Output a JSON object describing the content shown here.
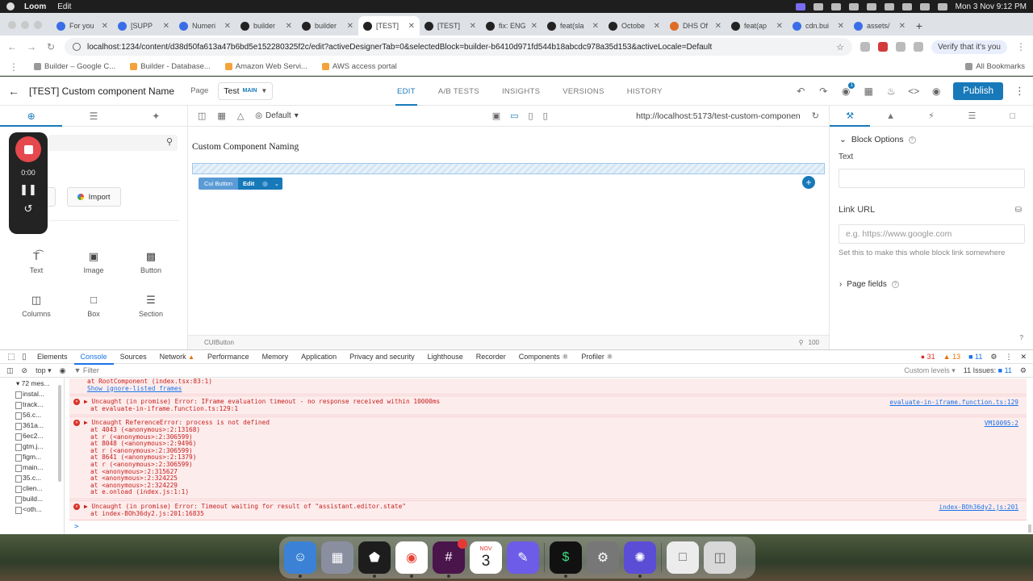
{
  "menubar": {
    "app": "Loom",
    "menu": "Edit",
    "datetime": "Mon 3 Nov  9:12 PM"
  },
  "browser": {
    "tabs": [
      {
        "label": "For you",
        "favicon": "blue"
      },
      {
        "label": "[SUPP",
        "favicon": "blue"
      },
      {
        "label": "Numeri",
        "favicon": "blue"
      },
      {
        "label": "builder",
        "favicon": "black"
      },
      {
        "label": "builder",
        "favicon": "black"
      },
      {
        "label": "[TEST]",
        "favicon": "black",
        "active": true
      },
      {
        "label": "[TEST]",
        "favicon": "black"
      },
      {
        "label": "fix: ENG",
        "favicon": "black"
      },
      {
        "label": "feat(sla",
        "favicon": "black"
      },
      {
        "label": "Octobe",
        "favicon": "black"
      },
      {
        "label": "DHS Of",
        "favicon": "orange"
      },
      {
        "label": "feat(ap",
        "favicon": "black"
      },
      {
        "label": "cdn.bui",
        "favicon": "blue"
      },
      {
        "label": "assets/",
        "favicon": "blue"
      }
    ],
    "url": "localhost:1234/content/d38d50fa613a47b6bd5e152280325f2c/edit?activeDesignerTab=0&selectedBlock=builder-b6410d971fd544b18abcdc978a35d153&activeLocale=Default",
    "verify_label": "Verify that it's you",
    "bookmarks": [
      {
        "label": "Builder – Google C...",
        "color": "grey"
      },
      {
        "label": "Builder - Database...",
        "color": "orange"
      },
      {
        "label": "Amazon Web Servi...",
        "color": "orange"
      },
      {
        "label": "AWS access portal",
        "color": "orange"
      }
    ],
    "all_bookmarks": "All Bookmarks"
  },
  "editor": {
    "title": "[TEST] Custom component Name",
    "type": "Page",
    "model": "Test",
    "model_branch": "MAIN",
    "tabs": [
      {
        "label": "EDIT",
        "active": true
      },
      {
        "label": "A/B TESTS"
      },
      {
        "label": "INSIGHTS"
      },
      {
        "label": "VERSIONS"
      },
      {
        "label": "HISTORY"
      }
    ],
    "notification_count": "1",
    "publish_label": "Publish"
  },
  "left_panel": {
    "import_buttons": [
      "t",
      "Import"
    ],
    "blocks": [
      {
        "label": "Text",
        "icon": "text-icon"
      },
      {
        "label": "Image",
        "icon": "image-icon"
      },
      {
        "label": "Button",
        "icon": "button-icon"
      },
      {
        "label": "Columns",
        "icon": "columns-icon"
      },
      {
        "label": "Box",
        "icon": "box-icon"
      },
      {
        "label": "Section",
        "icon": "section-icon"
      }
    ]
  },
  "loom": {
    "time": "0:00"
  },
  "canvas": {
    "locale": "Default",
    "preview_url": "http://localhost:5173/test-custom-componen",
    "heading": "Custom Component Naming",
    "chip_name": "Cui Button",
    "chip_edit": "Edit",
    "footer_path": "CUIButton",
    "zoom": "100"
  },
  "right_panel": {
    "block_options": "Block Options",
    "text_label": "Text",
    "text_value": "",
    "link_label": "Link URL",
    "link_placeholder": "e.g. https://www.google.com",
    "link_hint": "Set this to make this whole block link somewhere",
    "page_fields": "Page fields"
  },
  "devtools": {
    "tabs": [
      {
        "label": "Elements"
      },
      {
        "label": "Console",
        "active": true
      },
      {
        "label": "Sources"
      },
      {
        "label": "Network",
        "warn": true
      },
      {
        "label": "Performance"
      },
      {
        "label": "Memory"
      },
      {
        "label": "Application"
      },
      {
        "label": "Privacy and security"
      },
      {
        "label": "Lighthouse"
      },
      {
        "label": "Recorder"
      },
      {
        "label": "Components ⚛"
      },
      {
        "label": "Profiler ⚛"
      }
    ],
    "errors": "31",
    "warnings": "13",
    "info": "11",
    "context": "top",
    "filter_label": "Filter",
    "levels": "Custom levels ▾",
    "issues": "11 Issues:",
    "issues_count": "11",
    "sidebar": {
      "header": "72 mes...",
      "items": [
        "instal...",
        "track...",
        "56.c...",
        "361a...",
        "6ec2...",
        "gtm.j...",
        "figm...",
        "main...",
        "35.c...",
        "clien...",
        "build...",
        "<oth..."
      ]
    },
    "console": {
      "top_cut": "at RootComponent (index.tsx:83:1)",
      "show_ignore": "Show ignore-listed frames",
      "entries": [
        {
          "message": "▶ Uncaught (in promise) Error: IFrame evaluation timeout - no response received within 10000ms",
          "trace": [
            "at evaluate-in-iframe.function.ts:129:1"
          ],
          "source": "evaluate-in-iframe.function.ts:129"
        },
        {
          "message": "▶ Uncaught ReferenceError: process is not defined",
          "trace": [
            "at 4043 (<anonymous>:2:13168)",
            "at r (<anonymous>:2:306599)",
            "at 8048 (<anonymous>:2:9496)",
            "at r (<anonymous>:2:306599)",
            "at 8641 (<anonymous>:2:1379)",
            "at r (<anonymous>:2:306599)",
            "at <anonymous>:2:315627",
            "at <anonymous>:2:324225",
            "at <anonymous>:2:324229",
            "at e.onload (index.js:1:1)"
          ],
          "source": "VM10095:2"
        },
        {
          "message": "▶ Uncaught (in promise) Error: Timeout waiting for result of \"assistant.editor.state\"",
          "trace": [
            "at index-BOh36dy2.js:201:16835"
          ],
          "source": "index-BOh36dy2.js:201"
        }
      ],
      "prompt": ">"
    }
  },
  "dock": {
    "calendar_month": "NOV",
    "calendar_day": "3"
  }
}
